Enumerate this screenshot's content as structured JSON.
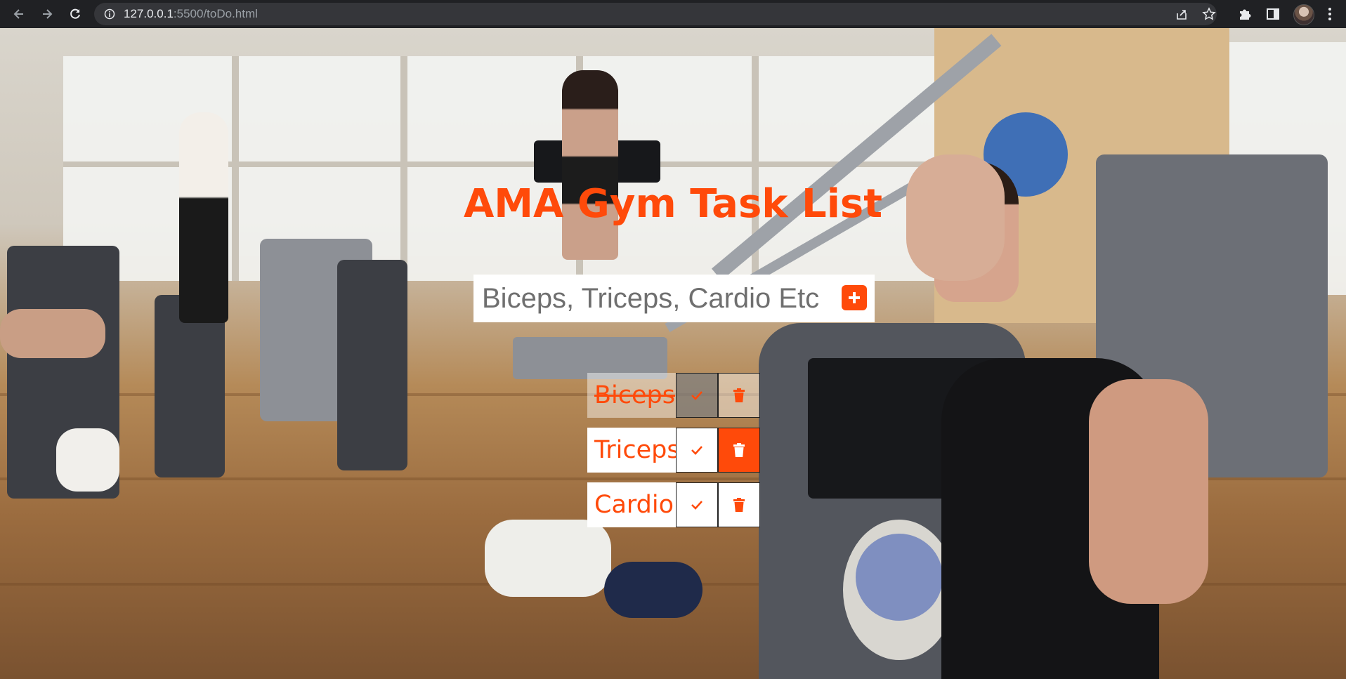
{
  "browser": {
    "url_host": "127.0.0.1",
    "url_rest": ":5500/toDo.html",
    "icons": [
      "back-arrow-icon",
      "forward-arrow-icon",
      "reload-icon",
      "info-icon",
      "share-icon",
      "bookmark-star-icon",
      "extensions-puzzle-icon",
      "side-panel-icon",
      "profile-avatar",
      "kebab-menu-icon"
    ]
  },
  "app": {
    "title": "AMA Gym Task List",
    "input_placeholder": "Biceps, Triceps, Cardio Etc",
    "add_icon": "plus-icon",
    "accent_color": "#ff4a0a",
    "tasks": [
      {
        "label": "Biceps",
        "completed": true
      },
      {
        "label": "Triceps",
        "completed": false
      },
      {
        "label": "Cardio",
        "completed": false
      }
    ],
    "task_icons": [
      "checkmark-icon",
      "trash-icon"
    ]
  }
}
